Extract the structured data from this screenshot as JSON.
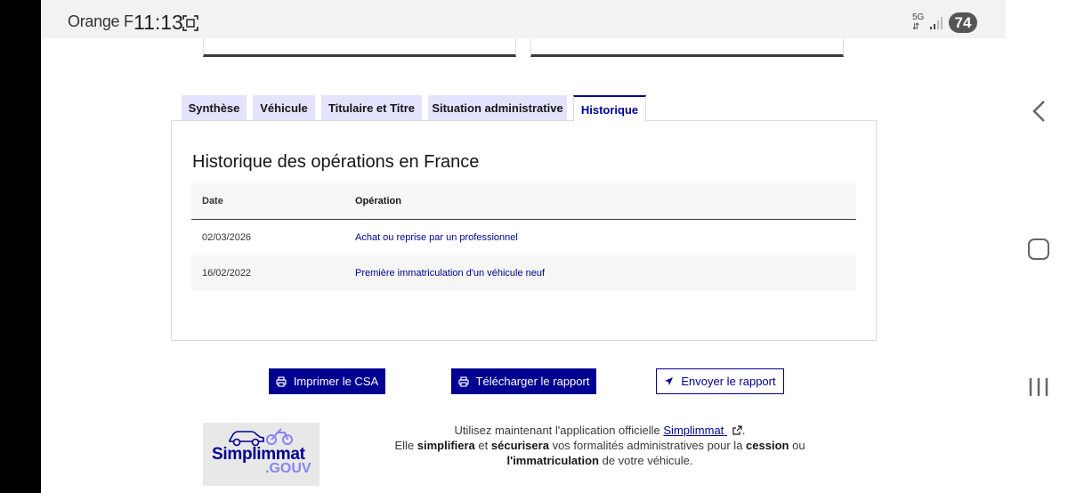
{
  "status_bar": {
    "carrier": "Orange F",
    "time": "11:13",
    "network": "5G",
    "battery": "74",
    "icons": [
      "screen-capture-icon",
      "data-arrows-icon",
      "signal-icon",
      "battery-icon"
    ]
  },
  "tabs": [
    {
      "label": "Synthèse",
      "active": false
    },
    {
      "label": "Véhicule",
      "active": false
    },
    {
      "label": "Titulaire et Titre",
      "active": false
    },
    {
      "label": "Situation administrative",
      "active": false
    },
    {
      "label": "Historique",
      "active": true
    }
  ],
  "history": {
    "title": "Historique des opérations en France",
    "columns": [
      "Date",
      "Opération"
    ],
    "rows": [
      {
        "date": "02/03/2026",
        "operation": "Achat ou reprise par un professionnel"
      },
      {
        "date": "16/02/2022",
        "operation": "Première immatriculation d'un véhicule neuf"
      }
    ]
  },
  "actions": {
    "print": {
      "label": "Imprimer le CSA",
      "icon": "printer-icon"
    },
    "download": {
      "label": "Télécharger le rapport",
      "icon": "printer-icon"
    },
    "send": {
      "label": "Envoyer le rapport",
      "icon": "send-icon"
    }
  },
  "promo": {
    "logo_word": "Simplimmat",
    "logo_suffix": ".GOUV",
    "line1_prefix": "Utilisez maintenant l'application officielle",
    "link": "Simplimmat",
    "line1_suffix": ".",
    "line2_a": "Elle",
    "bold1": "simplifiera",
    "line2_b": "et",
    "bold2": "sécurisera",
    "line2_c": "vos formalités administratives pour la",
    "bold3": "cession",
    "line2_d": "ou",
    "bold4": "l'immatriculation",
    "line2_e": "de votre véhicule."
  },
  "colors": {
    "primary": "#000091",
    "tab_bg": "#e3e3fd",
    "logo_accent": "#8585f6"
  },
  "system_nav": [
    "back-icon",
    "home-icon",
    "recents-icon"
  ]
}
